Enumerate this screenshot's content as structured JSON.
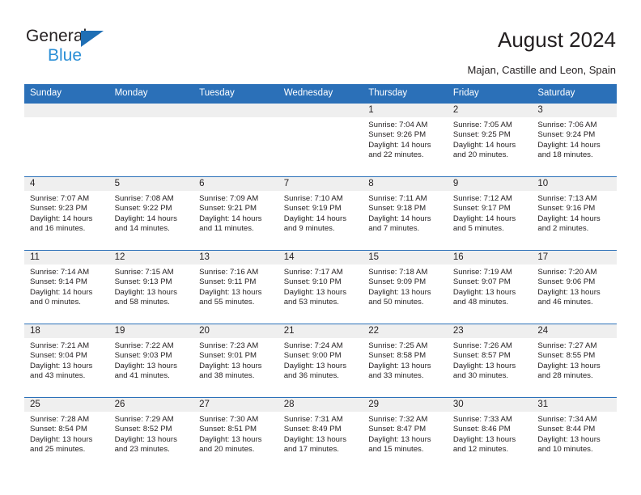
{
  "logo": {
    "word_top": "General",
    "word_bottom": "Blue",
    "triangle_color": "#1f6fb5",
    "blue_text_color": "#2b8fd6"
  },
  "header": {
    "title": "August 2024",
    "subtitle": "Majan, Castille and Leon, Spain"
  },
  "theme": {
    "header_blue": "#2b70b8",
    "daynum_band": "#efefef",
    "text": "#231f20"
  },
  "calendar": {
    "weekday_headers": [
      "Sunday",
      "Monday",
      "Tuesday",
      "Wednesday",
      "Thursday",
      "Friday",
      "Saturday"
    ],
    "weeks": [
      [
        {
          "day": "",
          "empty": true
        },
        {
          "day": "",
          "empty": true
        },
        {
          "day": "",
          "empty": true
        },
        {
          "day": "",
          "empty": true
        },
        {
          "day": "1",
          "sunrise": "Sunrise: 7:04 AM",
          "sunset": "Sunset: 9:26 PM",
          "daylight1": "Daylight: 14 hours",
          "daylight2": "and 22 minutes."
        },
        {
          "day": "2",
          "sunrise": "Sunrise: 7:05 AM",
          "sunset": "Sunset: 9:25 PM",
          "daylight1": "Daylight: 14 hours",
          "daylight2": "and 20 minutes."
        },
        {
          "day": "3",
          "sunrise": "Sunrise: 7:06 AM",
          "sunset": "Sunset: 9:24 PM",
          "daylight1": "Daylight: 14 hours",
          "daylight2": "and 18 minutes."
        }
      ],
      [
        {
          "day": "4",
          "sunrise": "Sunrise: 7:07 AM",
          "sunset": "Sunset: 9:23 PM",
          "daylight1": "Daylight: 14 hours",
          "daylight2": "and 16 minutes."
        },
        {
          "day": "5",
          "sunrise": "Sunrise: 7:08 AM",
          "sunset": "Sunset: 9:22 PM",
          "daylight1": "Daylight: 14 hours",
          "daylight2": "and 14 minutes."
        },
        {
          "day": "6",
          "sunrise": "Sunrise: 7:09 AM",
          "sunset": "Sunset: 9:21 PM",
          "daylight1": "Daylight: 14 hours",
          "daylight2": "and 11 minutes."
        },
        {
          "day": "7",
          "sunrise": "Sunrise: 7:10 AM",
          "sunset": "Sunset: 9:19 PM",
          "daylight1": "Daylight: 14 hours",
          "daylight2": "and 9 minutes."
        },
        {
          "day": "8",
          "sunrise": "Sunrise: 7:11 AM",
          "sunset": "Sunset: 9:18 PM",
          "daylight1": "Daylight: 14 hours",
          "daylight2": "and 7 minutes."
        },
        {
          "day": "9",
          "sunrise": "Sunrise: 7:12 AM",
          "sunset": "Sunset: 9:17 PM",
          "daylight1": "Daylight: 14 hours",
          "daylight2": "and 5 minutes."
        },
        {
          "day": "10",
          "sunrise": "Sunrise: 7:13 AM",
          "sunset": "Sunset: 9:16 PM",
          "daylight1": "Daylight: 14 hours",
          "daylight2": "and 2 minutes."
        }
      ],
      [
        {
          "day": "11",
          "sunrise": "Sunrise: 7:14 AM",
          "sunset": "Sunset: 9:14 PM",
          "daylight1": "Daylight: 14 hours",
          "daylight2": "and 0 minutes."
        },
        {
          "day": "12",
          "sunrise": "Sunrise: 7:15 AM",
          "sunset": "Sunset: 9:13 PM",
          "daylight1": "Daylight: 13 hours",
          "daylight2": "and 58 minutes."
        },
        {
          "day": "13",
          "sunrise": "Sunrise: 7:16 AM",
          "sunset": "Sunset: 9:11 PM",
          "daylight1": "Daylight: 13 hours",
          "daylight2": "and 55 minutes."
        },
        {
          "day": "14",
          "sunrise": "Sunrise: 7:17 AM",
          "sunset": "Sunset: 9:10 PM",
          "daylight1": "Daylight: 13 hours",
          "daylight2": "and 53 minutes."
        },
        {
          "day": "15",
          "sunrise": "Sunrise: 7:18 AM",
          "sunset": "Sunset: 9:09 PM",
          "daylight1": "Daylight: 13 hours",
          "daylight2": "and 50 minutes."
        },
        {
          "day": "16",
          "sunrise": "Sunrise: 7:19 AM",
          "sunset": "Sunset: 9:07 PM",
          "daylight1": "Daylight: 13 hours",
          "daylight2": "and 48 minutes."
        },
        {
          "day": "17",
          "sunrise": "Sunrise: 7:20 AM",
          "sunset": "Sunset: 9:06 PM",
          "daylight1": "Daylight: 13 hours",
          "daylight2": "and 46 minutes."
        }
      ],
      [
        {
          "day": "18",
          "sunrise": "Sunrise: 7:21 AM",
          "sunset": "Sunset: 9:04 PM",
          "daylight1": "Daylight: 13 hours",
          "daylight2": "and 43 minutes."
        },
        {
          "day": "19",
          "sunrise": "Sunrise: 7:22 AM",
          "sunset": "Sunset: 9:03 PM",
          "daylight1": "Daylight: 13 hours",
          "daylight2": "and 41 minutes."
        },
        {
          "day": "20",
          "sunrise": "Sunrise: 7:23 AM",
          "sunset": "Sunset: 9:01 PM",
          "daylight1": "Daylight: 13 hours",
          "daylight2": "and 38 minutes."
        },
        {
          "day": "21",
          "sunrise": "Sunrise: 7:24 AM",
          "sunset": "Sunset: 9:00 PM",
          "daylight1": "Daylight: 13 hours",
          "daylight2": "and 36 minutes."
        },
        {
          "day": "22",
          "sunrise": "Sunrise: 7:25 AM",
          "sunset": "Sunset: 8:58 PM",
          "daylight1": "Daylight: 13 hours",
          "daylight2": "and 33 minutes."
        },
        {
          "day": "23",
          "sunrise": "Sunrise: 7:26 AM",
          "sunset": "Sunset: 8:57 PM",
          "daylight1": "Daylight: 13 hours",
          "daylight2": "and 30 minutes."
        },
        {
          "day": "24",
          "sunrise": "Sunrise: 7:27 AM",
          "sunset": "Sunset: 8:55 PM",
          "daylight1": "Daylight: 13 hours",
          "daylight2": "and 28 minutes."
        }
      ],
      [
        {
          "day": "25",
          "sunrise": "Sunrise: 7:28 AM",
          "sunset": "Sunset: 8:54 PM",
          "daylight1": "Daylight: 13 hours",
          "daylight2": "and 25 minutes."
        },
        {
          "day": "26",
          "sunrise": "Sunrise: 7:29 AM",
          "sunset": "Sunset: 8:52 PM",
          "daylight1": "Daylight: 13 hours",
          "daylight2": "and 23 minutes."
        },
        {
          "day": "27",
          "sunrise": "Sunrise: 7:30 AM",
          "sunset": "Sunset: 8:51 PM",
          "daylight1": "Daylight: 13 hours",
          "daylight2": "and 20 minutes."
        },
        {
          "day": "28",
          "sunrise": "Sunrise: 7:31 AM",
          "sunset": "Sunset: 8:49 PM",
          "daylight1": "Daylight: 13 hours",
          "daylight2": "and 17 minutes."
        },
        {
          "day": "29",
          "sunrise": "Sunrise: 7:32 AM",
          "sunset": "Sunset: 8:47 PM",
          "daylight1": "Daylight: 13 hours",
          "daylight2": "and 15 minutes."
        },
        {
          "day": "30",
          "sunrise": "Sunrise: 7:33 AM",
          "sunset": "Sunset: 8:46 PM",
          "daylight1": "Daylight: 13 hours",
          "daylight2": "and 12 minutes."
        },
        {
          "day": "31",
          "sunrise": "Sunrise: 7:34 AM",
          "sunset": "Sunset: 8:44 PM",
          "daylight1": "Daylight: 13 hours",
          "daylight2": "and 10 minutes."
        }
      ]
    ]
  }
}
